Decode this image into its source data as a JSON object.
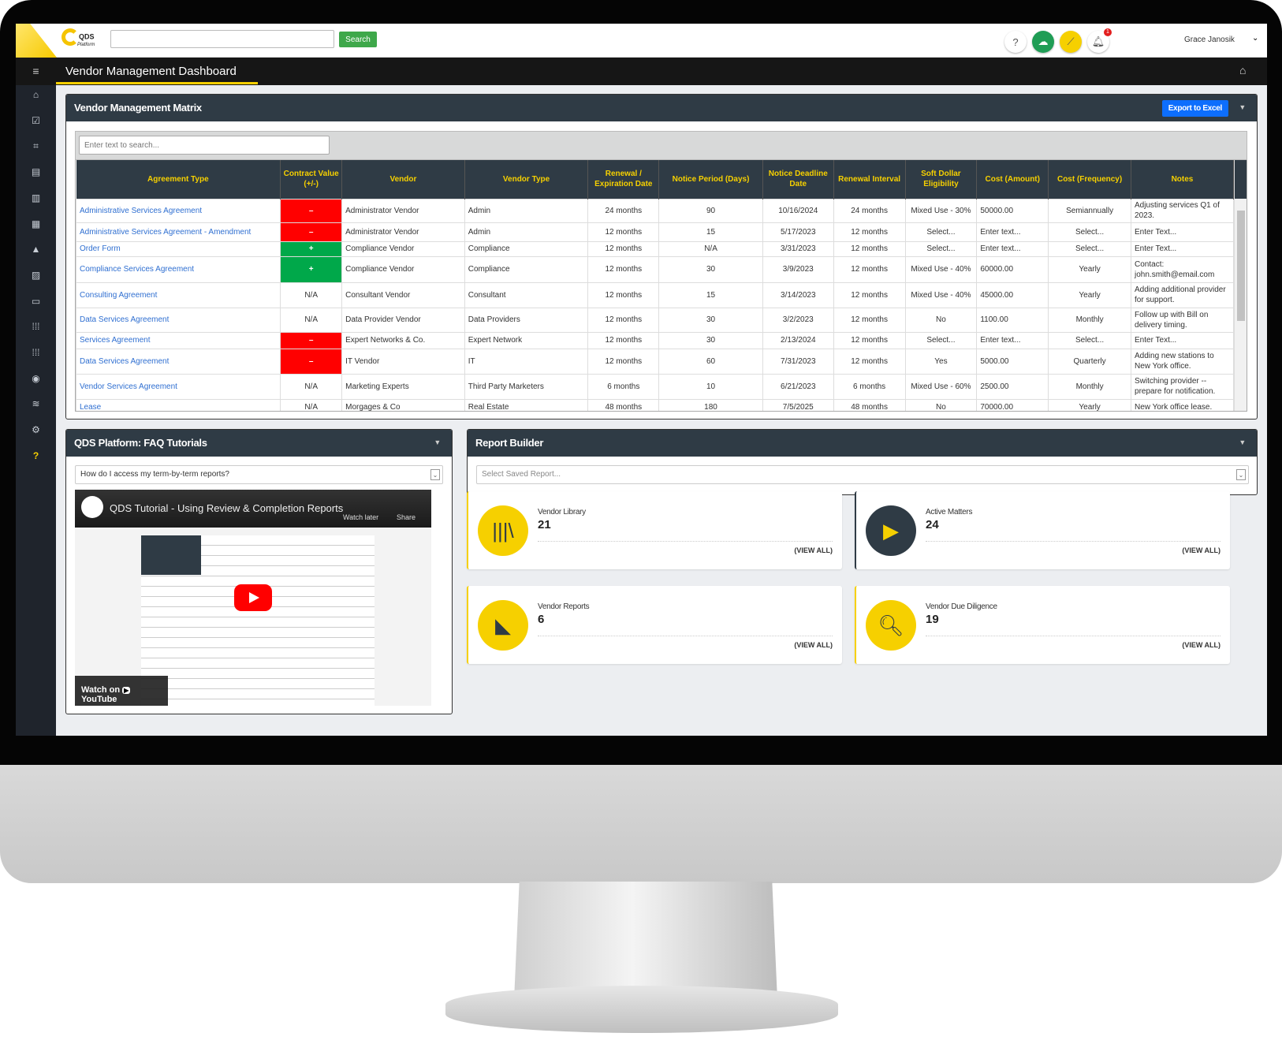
{
  "header": {
    "logo_text": "QDS",
    "logo_sub": "Platform",
    "search_value": "",
    "search_label": "Search",
    "user": "Grace Janosik",
    "notifications": "1",
    "icons": [
      "help-icon",
      "cloud-upload-icon",
      "chart-icon",
      "bell-icon"
    ]
  },
  "page": {
    "title": "Vendor Management Dashboard"
  },
  "sidebar": {
    "icons": [
      "home-icon",
      "clipboard-check-icon",
      "vector-icon",
      "document-icon",
      "report-icon",
      "building-icon",
      "shapes-icon",
      "chart-icon",
      "comment-icon",
      "grid-icon",
      "grid-icon",
      "eye-icon",
      "database-icon",
      "gear-icon",
      "help-icon"
    ]
  },
  "matrix": {
    "title": "Vendor Management Matrix",
    "export_label": "Export to Excel",
    "search_placeholder": "Enter text to search...",
    "columns": [
      "Agreement Type",
      "Contract Value (+/-)",
      "Vendor",
      "Vendor Type",
      "Renewal / Expiration Date",
      "Notice Period (Days)",
      "Notice Deadline Date",
      "Renewal Interval",
      "Soft Dollar Eligibility",
      "Cost (Amount)",
      "Cost (Frequency)",
      "Notes"
    ],
    "rows": [
      {
        "agreement": "Administrative Services Agreement",
        "value": "–",
        "value_status": "negative",
        "vendor": "Administrator Vendor",
        "type": "Admin",
        "renewal": "24 months",
        "notice": "90",
        "deadline": "10/16/2024",
        "interval": "24 months",
        "soft": "Mixed Use - 30%",
        "cost": "50000.00",
        "freq": "Semiannually",
        "notes": "Adjusting services Q1 of 2023."
      },
      {
        "agreement": "Administrative Services Agreement - Amendment",
        "value": "–",
        "value_status": "negative",
        "vendor": "Administrator Vendor",
        "type": "Admin",
        "renewal": "12 months",
        "notice": "15",
        "deadline": "5/17/2023",
        "interval": "12 months",
        "soft": "Select...",
        "cost": "Enter text...",
        "freq": "Select...",
        "notes": "Enter Text..."
      },
      {
        "agreement": "Order Form",
        "value": "+",
        "value_status": "positive",
        "vendor": "Compliance Vendor",
        "type": "Compliance",
        "renewal": "12 months",
        "notice": "N/A",
        "deadline": "3/31/2023",
        "interval": "12 months",
        "soft": "Select...",
        "cost": "Enter text...",
        "freq": "Select...",
        "notes": "Enter Text..."
      },
      {
        "agreement": "Compliance Services Agreement",
        "value": "+",
        "value_status": "positive",
        "vendor": "Compliance Vendor",
        "type": "Compliance",
        "renewal": "12 months",
        "notice": "30",
        "deadline": "3/9/2023",
        "interval": "12 months",
        "soft": "Mixed Use - 40%",
        "cost": "60000.00",
        "freq": "Yearly",
        "notes": "Contact: john.smith@email.com"
      },
      {
        "agreement": "Consulting Agreement",
        "value": "N/A",
        "value_status": "none",
        "vendor": "Consultant Vendor",
        "type": "Consultant",
        "renewal": "12 months",
        "notice": "15",
        "deadline": "3/14/2023",
        "interval": "12 months",
        "soft": "Mixed Use - 40%",
        "cost": "45000.00",
        "freq": "Yearly",
        "notes": "Adding additional provider for support."
      },
      {
        "agreement": "Data Services Agreement",
        "value": "N/A",
        "value_status": "none",
        "vendor": "Data Provider Vendor",
        "type": "Data Providers",
        "renewal": "12 months",
        "notice": "30",
        "deadline": "3/2/2023",
        "interval": "12 months",
        "soft": "No",
        "cost": "1100.00",
        "freq": "Monthly",
        "notes": "Follow up with Bill on delivery timing."
      },
      {
        "agreement": "Services Agreement",
        "value": "–",
        "value_status": "negative",
        "vendor": "Expert Networks & Co.",
        "type": "Expert Network",
        "renewal": "12 months",
        "notice": "30",
        "deadline": "2/13/2024",
        "interval": "12 months",
        "soft": "Select...",
        "cost": "Enter text...",
        "freq": "Select...",
        "notes": "Enter Text..."
      },
      {
        "agreement": "Data Services Agreement",
        "value": "–",
        "value_status": "negative",
        "vendor": "IT Vendor",
        "type": "IT",
        "renewal": "12 months",
        "notice": "60",
        "deadline": "7/31/2023",
        "interval": "12 months",
        "soft": "Yes",
        "cost": "5000.00",
        "freq": "Quarterly",
        "notes": "Adding new stations to New York office."
      },
      {
        "agreement": "Vendor Services Agreement",
        "value": "N/A",
        "value_status": "none",
        "vendor": "Marketing Experts",
        "type": "Third Party Marketers",
        "renewal": "6 months",
        "notice": "10",
        "deadline": "6/21/2023",
        "interval": "6 months",
        "soft": "Mixed Use - 60%",
        "cost": "2500.00",
        "freq": "Monthly",
        "notes": "Switching provider -- prepare for notification."
      },
      {
        "agreement": "Lease",
        "value": "N/A",
        "value_status": "none",
        "vendor": "Morgages & Co",
        "type": "Real Estate",
        "renewal": "48 months",
        "notice": "180",
        "deadline": "7/5/2025",
        "interval": "48 months",
        "soft": "No",
        "cost": "70000.00",
        "freq": "Yearly",
        "notes": "New York office lease."
      }
    ]
  },
  "faq": {
    "title": "QDS Platform: FAQ Tutorials",
    "question": "How do I access my term-by-term reports?",
    "video_title": "QDS Tutorial - Using Review & Completion Reports",
    "watch_later": "Watch later",
    "share": "Share",
    "watch_on": "Watch on",
    "youtube": "YouTube"
  },
  "report_builder": {
    "title": "Report Builder",
    "placeholder": "Select Saved Report..."
  },
  "cards": [
    {
      "label": "Vendor Library",
      "count": "21",
      "link": "(VIEW ALL)",
      "icon": "books-icon"
    },
    {
      "label": "Active Matters",
      "count": "24",
      "link": "(VIEW ALL)",
      "icon": "play-circle-icon"
    },
    {
      "label": "Vendor Reports",
      "count": "6",
      "link": "(VIEW ALL)",
      "icon": "area-chart-icon"
    },
    {
      "label": "Vendor Due Diligence",
      "count": "19",
      "link": "(VIEW ALL)",
      "icon": "file-search-icon"
    }
  ],
  "colors": {
    "accent": "#f6d000",
    "header_dark": "#2f3b45",
    "negative": "#ff0000",
    "positive": "#00a84a",
    "export": "#0d6efd",
    "search": "#3ea84a"
  }
}
